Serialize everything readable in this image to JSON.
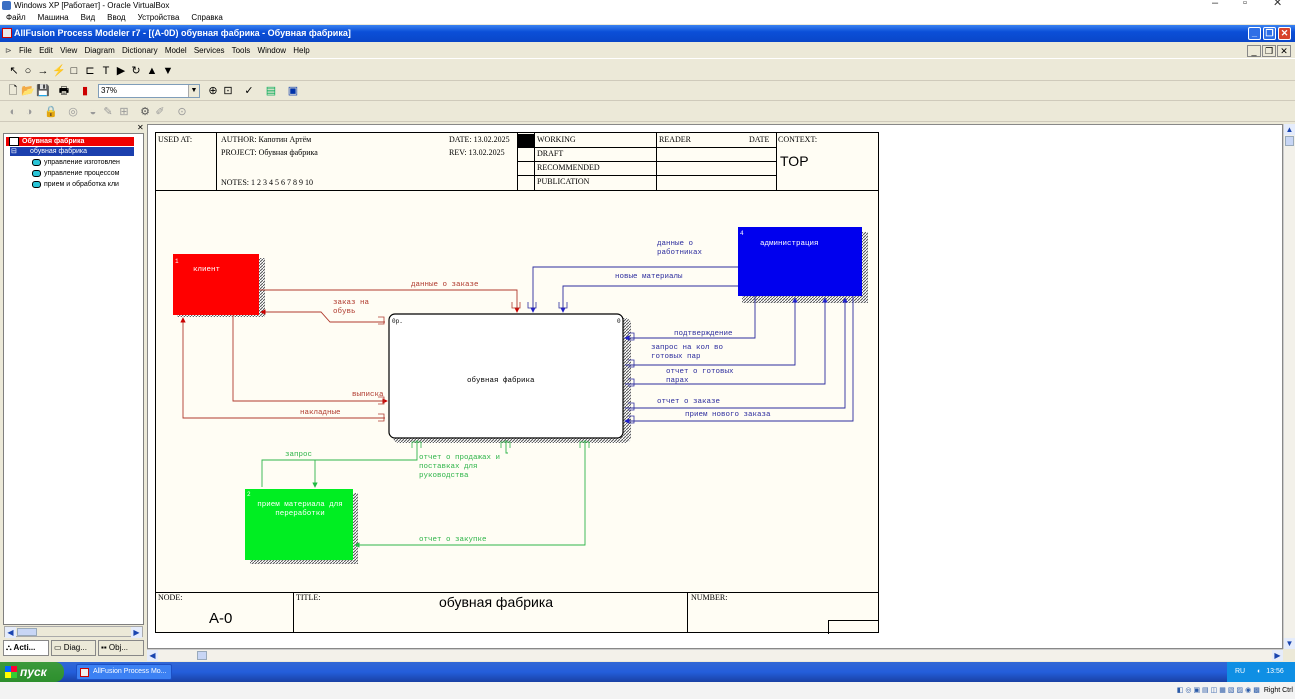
{
  "host": {
    "title": "Windows XP [Работает] - Oracle VirtualBox",
    "menu": [
      "Файл",
      "Машина",
      "Вид",
      "Ввод",
      "Устройства",
      "Справка"
    ],
    "status": "Right Ctrl"
  },
  "window": {
    "title": "AllFusion Process Modeler r7 - [(A-0D) обувная фабрика  - Обувная фабрика]"
  },
  "menu": [
    "File",
    "Edit",
    "View",
    "Diagram",
    "Dictionary",
    "Model",
    "Services",
    "Tools",
    "Window",
    "Help"
  ],
  "toolbar": {
    "zoom": "37%"
  },
  "tree": {
    "root": "Обувная фабрика",
    "child": "обувная фабрика",
    "items": [
      "управление изготовлен",
      "управление процессом",
      "прием и обработка кли"
    ]
  },
  "tabs": [
    "Acti...",
    "Diag...",
    "Obj..."
  ],
  "header": {
    "used_at": "USED AT:",
    "author": "AUTHOR:  Капотин Артём",
    "project": "PROJECT:  Обувная фабрика",
    "notes": "NOTES:  1  2  3  4  5  6  7  8  9  10",
    "date": "DATE:  13.02.2025",
    "rev": "REV:     13.02.2025",
    "status": [
      "WORKING",
      "DRAFT",
      "RECOMMENDED",
      "PUBLICATION"
    ],
    "reader": "READER",
    "date_col": "DATE",
    "context": "CONTEXT:",
    "context_value": "TOP"
  },
  "footer": {
    "node": "NODE:",
    "node_value": "A-0",
    "title": "TITLE:",
    "title_value": "обувная фабрика",
    "number": "NUMBER:"
  },
  "diagram": {
    "main": {
      "label": "обувная фабрика",
      "corner_left": "0р.",
      "corner_right": "0"
    },
    "client": {
      "label": "клиент",
      "num": "1"
    },
    "admin": {
      "label": "администрация",
      "num": "4"
    },
    "material": {
      "label": "прием материала для переработки",
      "num": "2"
    },
    "arrows": {
      "order_data": "данные о заказе",
      "shoe_order": "заказ на обувь",
      "receipt": "выписка",
      "invoice": "накладные",
      "employee_data": "данные о работниках",
      "new_materials": "новые материалы",
      "confirmation": "подтверждение",
      "count_request": "запрос на кол во готовых пар",
      "ready_report": "отчет о готовых парах",
      "order_report": "отчет о заказе",
      "new_order": "прием нового заказа",
      "request": "запрос",
      "sales_report": "отчет о продажах и поставках для руководства",
      "purchase_report": "отчет о закупке"
    },
    "colors": {
      "red": "#ff0000",
      "blue": "#0000ee",
      "green": "#00ee22",
      "red_arrow": "#b03a2e",
      "blue_arrow": "#2d2d9e",
      "green_arrow": "#2fb54a"
    }
  },
  "taskbar": {
    "start": "пуск",
    "item": "AllFusion Process Mo...",
    "lang": "RU",
    "time": "13:56"
  }
}
